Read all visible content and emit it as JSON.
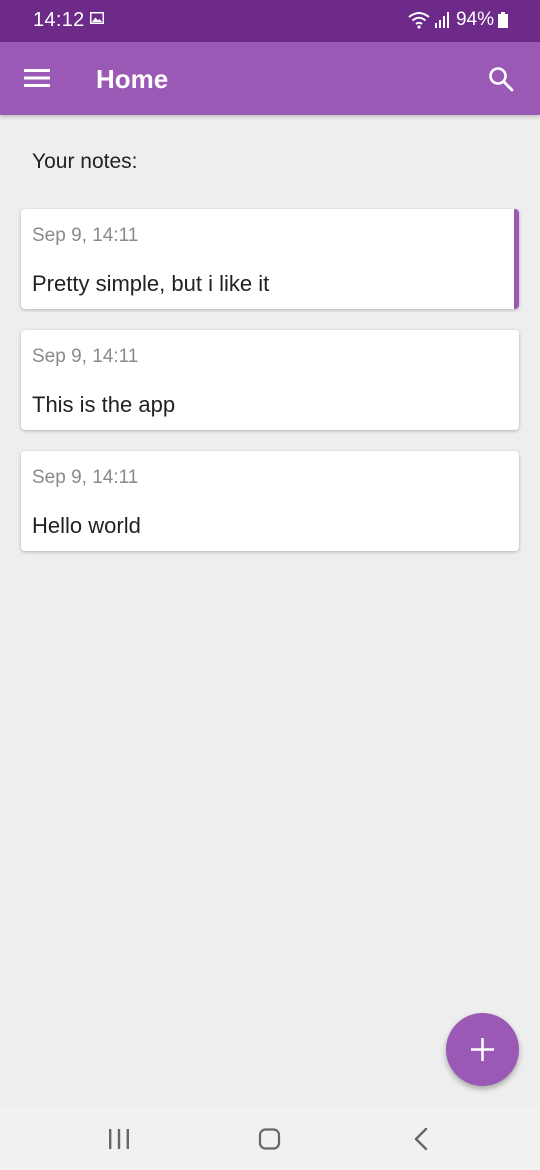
{
  "status_bar": {
    "time": "14:12",
    "battery": "94%"
  },
  "app_bar": {
    "title": "Home"
  },
  "main": {
    "section_label": "Your notes:",
    "notes": [
      {
        "date": "Sep 9, 14:11",
        "text": "Pretty simple, but i like it",
        "selected": true
      },
      {
        "date": "Sep 9, 14:11",
        "text": "This is the app",
        "selected": false
      },
      {
        "date": "Sep 9, 14:11",
        "text": "Hello world",
        "selected": false
      }
    ]
  },
  "icons": {
    "menu": "menu-icon",
    "search": "search-icon",
    "fab": "plus-icon",
    "nav": [
      "recents-icon",
      "home-icon",
      "back-icon"
    ]
  },
  "colors": {
    "status_bar": "#6d2a88",
    "primary": "#9b59b6",
    "background": "#eeeeee",
    "card": "#ffffff"
  }
}
